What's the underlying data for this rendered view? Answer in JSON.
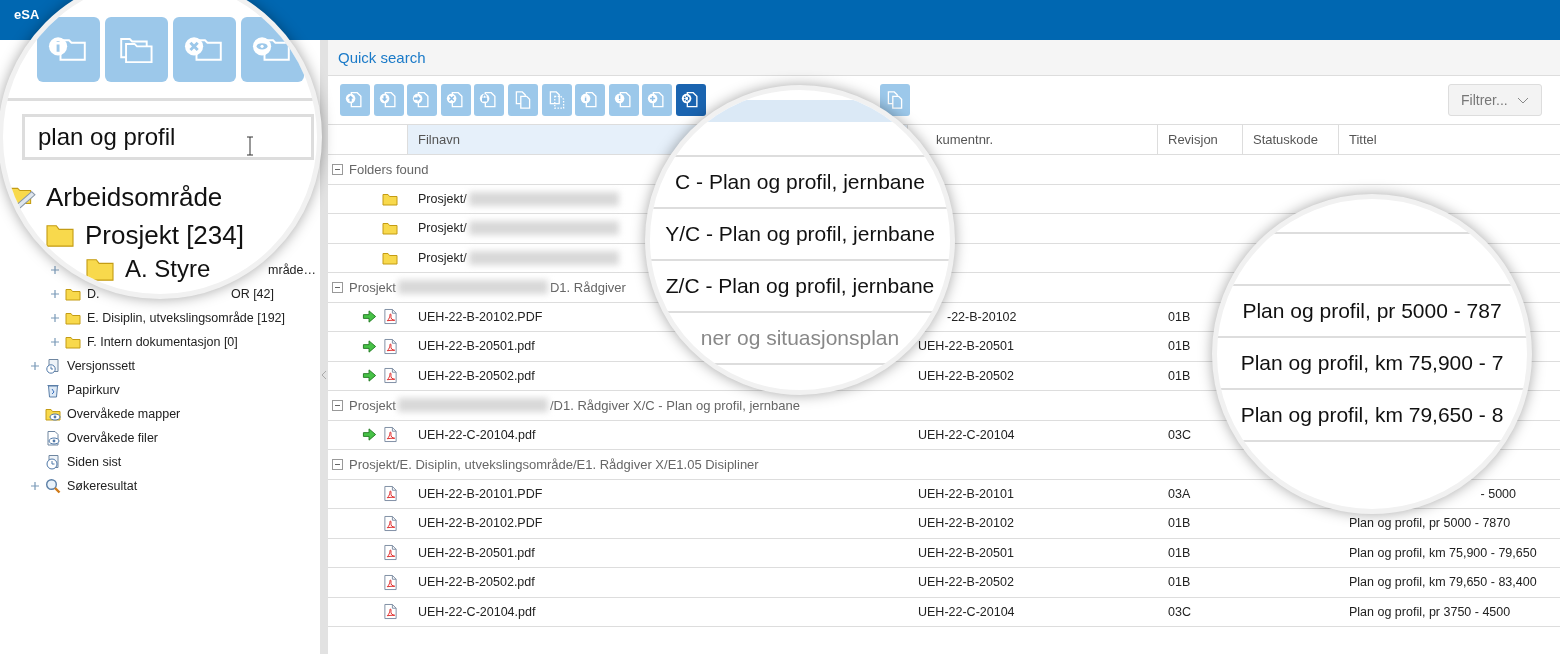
{
  "header": {
    "title": "eSA"
  },
  "sidebar": {
    "folder_items": [
      {
        "kind": "fragment",
        "expandable": true,
        "label_end": "mråde…"
      },
      {
        "kind": "folder",
        "expandable": true,
        "label": "D.",
        "label_end": "OR [42]"
      },
      {
        "kind": "folder",
        "expandable": true,
        "label": "E. Disiplin, utvekslingsområde [192]"
      },
      {
        "kind": "folder",
        "expandable": true,
        "label": "F. Intern dokumentasjon [0]"
      }
    ],
    "nav_items": [
      {
        "kind": "versions",
        "expandable": true,
        "label": "Versjonssett"
      },
      {
        "kind": "bin",
        "expandable": false,
        "label": "Papirkurv"
      },
      {
        "kind": "folder-eye",
        "expandable": false,
        "label": "Overvåkede mapper"
      },
      {
        "kind": "document-eye",
        "expandable": false,
        "label": "Overvåkede filer"
      },
      {
        "kind": "clock",
        "expandable": false,
        "label": "Siden sist"
      },
      {
        "kind": "search",
        "expandable": true,
        "label": "Søkeresultat"
      }
    ]
  },
  "quick_search": {
    "label": "Quick search"
  },
  "toolbar": {
    "buttons": [
      {
        "kind": "upload",
        "selected": false
      },
      {
        "kind": "download",
        "selected": false
      },
      {
        "kind": "forward",
        "selected": false
      },
      {
        "kind": "remove",
        "selected": false
      },
      {
        "kind": "lock",
        "selected": false
      },
      {
        "kind": "copy",
        "selected": false
      },
      {
        "kind": "dashed",
        "selected": false
      },
      {
        "kind": "info",
        "selected": false
      },
      {
        "kind": "warning",
        "selected": false
      },
      {
        "kind": "add",
        "selected": false
      },
      {
        "kind": "settings",
        "selected": true
      }
    ],
    "trailing_buttons": [
      {
        "kind": "copy",
        "selected": false
      }
    ],
    "filter": {
      "label": "Filtrer..."
    }
  },
  "table": {
    "columns": [
      {
        "label": "Filnavn",
        "highlighted": true
      },
      {
        "label": "kumentnr.",
        "highlighted": false
      },
      {
        "label": "Revisjon",
        "highlighted": false
      },
      {
        "label": "Statuskode",
        "highlighted": false
      },
      {
        "label": "Tittel",
        "highlighted": false
      }
    ],
    "groups": [
      {
        "expanded": true,
        "title": [
          {
            "kind": "text",
            "text": "Folders found"
          }
        ],
        "rows": [
          {
            "kind": "folder",
            "path": [
              {
                "kind": "text",
                "text": "Prosjekt/"
              },
              {
                "kind": "redacted"
              }
            ]
          },
          {
            "kind": "folder",
            "path": [
              {
                "kind": "text",
                "text": "Prosjekt/"
              },
              {
                "kind": "redacted"
              }
            ]
          },
          {
            "kind": "folder",
            "path": [
              {
                "kind": "text",
                "text": "Prosjekt/"
              },
              {
                "kind": "redacted"
              }
            ]
          }
        ]
      },
      {
        "expanded": true,
        "title": [
          {
            "kind": "text",
            "text": "Prosjekt"
          },
          {
            "kind": "redacted"
          },
          {
            "kind": "text",
            "text": "D1. Rådgiver"
          }
        ],
        "rows": [
          {
            "kind": "document",
            "synced": true,
            "file": "UEH-22-B-20102.PDF",
            "doc_no": "-22-B-20102",
            "doc_no_clipped": true,
            "revision": "01B"
          },
          {
            "kind": "document",
            "synced": true,
            "file": "UEH-22-B-20501.pdf",
            "doc_no": "UEH-22-B-20501",
            "revision": "01B"
          },
          {
            "kind": "document",
            "synced": true,
            "file": "UEH-22-B-20502.pdf",
            "doc_no": "UEH-22-B-20502",
            "revision": "01B"
          }
        ]
      },
      {
        "expanded": true,
        "title": [
          {
            "kind": "text",
            "text": "Prosjekt"
          },
          {
            "kind": "redacted"
          },
          {
            "kind": "text",
            "text": "/D1. Rådgiver X/C - Plan og profil, jernbane"
          }
        ],
        "rows": [
          {
            "kind": "document",
            "synced": true,
            "file": "UEH-22-C-20104.pdf",
            "doc_no": "UEH-22-C-20104",
            "revision": "03C"
          }
        ]
      },
      {
        "expanded": true,
        "title": [
          {
            "kind": "text",
            "text": "Prosjekt/E. Disiplin, utvekslingsområde/E1. Rådgiver X/E1.05 Disipliner"
          }
        ],
        "rows": [
          {
            "kind": "document",
            "synced": false,
            "file": "UEH-22-B-20101.PDF",
            "doc_no": "UEH-22-B-20101",
            "revision": "03A",
            "title": "- 5000",
            "title_clipped": true
          },
          {
            "kind": "document",
            "synced": false,
            "file": "UEH-22-B-20102.PDF",
            "doc_no": "UEH-22-B-20102",
            "revision": "01B",
            "title": "Plan og profil, pr 5000 - 7870",
            "title_clipped": false
          },
          {
            "kind": "document",
            "synced": false,
            "file": "UEH-22-B-20501.pdf",
            "doc_no": "UEH-22-B-20501",
            "revision": "01B",
            "title": "Plan og profil, km 75,900 - 79,650",
            "title_clipped": false
          },
          {
            "kind": "document",
            "synced": false,
            "file": "UEH-22-B-20502.pdf",
            "doc_no": "UEH-22-B-20502",
            "revision": "01B",
            "title": "Plan og profil, km 79,650 - 83,400",
            "title_clipped": false
          },
          {
            "kind": "document",
            "synced": false,
            "file": "UEH-22-C-20104.pdf",
            "doc_no": "UEH-22-C-20104",
            "revision": "03C",
            "title": "Plan og profil, pr 3750 - 4500",
            "title_clipped": false
          }
        ]
      }
    ]
  },
  "magnifiers": [
    {
      "kind": "sidebar",
      "buttons": [
        {
          "kind": "info"
        },
        {
          "kind": "plain"
        },
        {
          "kind": "remove"
        },
        {
          "kind": "eye"
        }
      ],
      "search": {
        "value": "plan og profil"
      },
      "tree": [
        {
          "kind": "workspace",
          "label": "Arbeidsområde",
          "children": [
            {
              "kind": "folder",
              "label": "Prosjekt [234]",
              "children": [
                {
                  "kind": "folder",
                  "label": "A. Styre"
                }
              ]
            }
          ]
        }
      ]
    },
    {
      "kind": "group-titles",
      "lines": [
        {
          "text": "C - Plan og profil, jernbane",
          "muted": false
        },
        {
          "text": "Y/C - Plan og profil, jernbane",
          "muted": false
        },
        {
          "text": "Z/C - Plan og profil, jernbane",
          "muted": false
        },
        {
          "text": "ner og situasjonsplan",
          "muted": true
        }
      ]
    },
    {
      "kind": "titles",
      "lines": [
        {
          "text": "Plan og profil, pr 5000 - 787",
          "muted": false
        },
        {
          "text": "Plan og profil, km 75,900 - 7",
          "muted": false
        },
        {
          "text": "Plan og profil, km 79,650 - 8",
          "muted": false
        }
      ]
    }
  ]
}
